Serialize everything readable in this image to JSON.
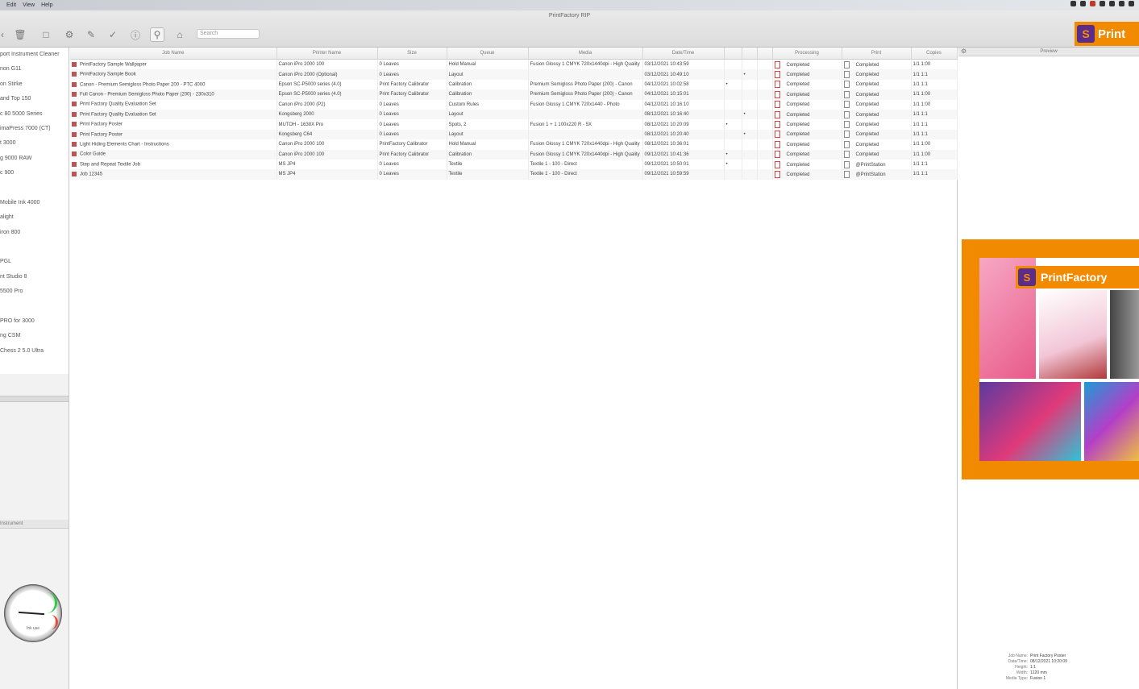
{
  "menu": [
    "Edit",
    "View",
    "Help"
  ],
  "window": {
    "title": "PrintFactory RIP"
  },
  "toolbar": {
    "search_placeholder": "Search"
  },
  "logo": {
    "text": "Print"
  },
  "sidebar": {
    "items": [
      "port Instrument Cleaner",
      "non G11",
      "on Stirke",
      "and Top 150",
      "c 80 5000 Series",
      "imaPress 7000 (CT)",
      "t 3000",
      "g 9000 RAW",
      "c 900",
      "",
      "Mobile Ink 4000",
      "alight",
      "iron 800",
      "",
      "PGL",
      "nt Studio 8",
      "5500 Pro",
      "",
      "PRO for 3000",
      "ng CSM",
      "Chess 2 5.0 Ultra"
    ],
    "lower_header": "Instrument",
    "gauge_label": "Ink use"
  },
  "table": {
    "columns": [
      "Job Name",
      "Printer Name",
      "Size",
      "Queue",
      "Media",
      "Date/Time",
      "",
      "",
      "",
      "Processing",
      "Print",
      "Copies"
    ],
    "rows": [
      [
        "PrintFactory Sample Wallpaper",
        "Canon iPro 2000 100",
        "0 Leaves",
        "Hold Manual",
        "Fusion Glossy 1 CMYK 720x1440dpi - High Quality",
        "03/12/2021 10:43:59",
        "",
        "",
        "",
        "Completed",
        "Completed",
        "1/1 1:00"
      ],
      [
        "PrintFactory Sample Book",
        "Canon iPro 2000 (Optional)",
        "0 Leaves",
        "Layout",
        "",
        "03/12/2021 10:49:10",
        "",
        "•",
        "",
        "Completed",
        "Completed",
        "1/1 1:1"
      ],
      [
        "Canon - Premium Semigloss Photo Paper 200 - PTC 4000",
        "Epson SC-P5000 series (4.0)",
        "Print Factory Calibrator",
        "Calibration",
        "Premium Semigloss Photo Paper (200) - Canon",
        "04/12/2021 10:02:58",
        "•",
        "",
        "",
        "Completed",
        "Completed",
        "1/1 1:1"
      ],
      [
        "Full Canon - Premium Semigloss Photo Paper (200) - 230x310",
        "Epson SC-P5000 series (4.0)",
        "Print Factory Calibrator",
        "Calibration",
        "Premium Semigloss Photo Paper (200) - Canon",
        "04/12/2021 10:15:01",
        "",
        "",
        "",
        "Completed",
        "Completed",
        "1/1 1:00"
      ],
      [
        "Print Factory Quality Evaluation Set",
        "Canon iPro 2000 (P2)",
        "0 Leaves",
        "Custom Rules",
        "Fusion Glossy 1 CMYK 720x1440 - Photo",
        "04/12/2021 10:16:10",
        "",
        "",
        "",
        "Completed",
        "Completed",
        "1/1 1:00"
      ],
      [
        "Print Factory Quality Evaluation Set",
        "Kongsberg 2000",
        "0 Leaves",
        "Layout",
        "",
        "08/12/2021 10:16:40",
        "",
        "•",
        "",
        "Completed",
        "Completed",
        "1/1 1:1"
      ],
      [
        "Print Factory Poster",
        "MUTOH - 1638X Pro",
        "0 Leaves",
        "Spots, 2",
        "Fusion 1 + 1 100x220 R - 5X",
        "08/12/2021 10:20:09",
        "•",
        "",
        "",
        "Completed",
        "Completed",
        "1/1 1:1"
      ],
      [
        "Print Factory Poster",
        "Kongsberg C64",
        "0 Leaves",
        "Layout",
        "",
        "08/12/2021 10:20:40",
        "",
        "•",
        "",
        "Completed",
        "Completed",
        "1/1 1:1"
      ],
      [
        "Light Hiding Elements Chart - Instructions",
        "Canon iPro 2000 100",
        "PrintFactory Calibrator",
        "Hold Manual",
        "Fusion Glossy 1 CMYK 720x1440dpi - High Quality",
        "08/12/2021 10:36:01",
        "",
        "",
        "",
        "Completed",
        "Completed",
        "1/1 1:00"
      ],
      [
        "Color Guide",
        "Canon iPro 2000 100",
        "Print Factory Calibrator",
        "Calibration",
        "Fusion Glossy 1 CMYK 720x1440dpi - High Quality",
        "09/12/2021 10:41:36",
        "•",
        "",
        "",
        "Completed",
        "Completed",
        "1/1 1:00"
      ],
      [
        "Step and Repeat Textile Job",
        "MS JP4",
        "0 Leaves",
        "Textile",
        "Textile 1 - 100 - Direct",
        "09/12/2021 10:50:01",
        "•",
        "",
        "",
        "Completed",
        "@PrintStation",
        "1/1 1:1"
      ],
      [
        "Job 12345",
        "MS JP4",
        "0 Leaves",
        "Textile",
        "Textile 1 - 100 - Direct",
        "09/12/2021 10:59:59",
        "",
        "",
        "",
        "Completed",
        "@PrintStation",
        "1/1 1:1"
      ]
    ]
  },
  "preview": {
    "header": "Preview",
    "banner_text": "PrintFactory",
    "meta": [
      [
        "Job Name:",
        "Print Factory Poster"
      ],
      [
        "Date/Time:",
        "08/12/2021 10:20:09"
      ],
      [
        "Height:",
        "1:1"
      ],
      [
        "Width:",
        "1220 mm"
      ],
      [
        "Media Type:",
        "Fusion 1"
      ]
    ]
  }
}
